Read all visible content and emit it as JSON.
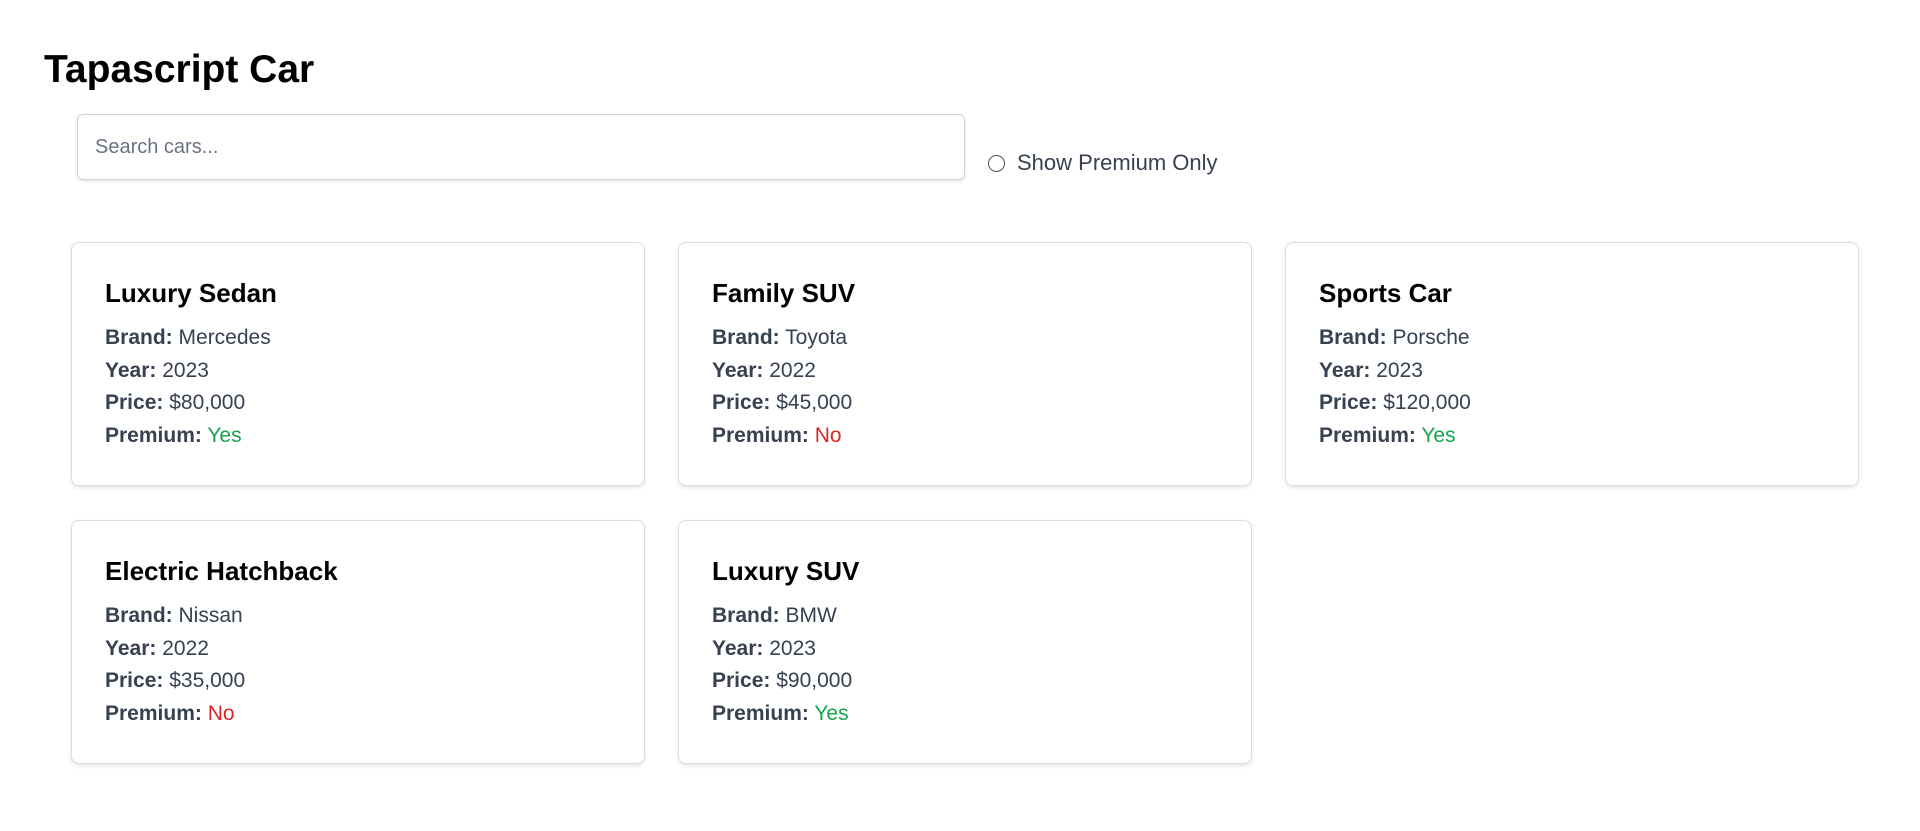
{
  "app": {
    "title": "Tapascript Car"
  },
  "controls": {
    "search_placeholder": "Search cars...",
    "search_value": "",
    "premium_label": "Show Premium Only",
    "premium_checked": false
  },
  "labels": {
    "brand": "Brand:",
    "year": "Year:",
    "price": "Price:",
    "premium": "Premium:"
  },
  "colors": {
    "yes": "#16a34a",
    "no": "#dc2626"
  },
  "cars": [
    {
      "name": "Luxury Sedan",
      "brand": "Mercedes",
      "year": "2023",
      "price": "$80,000",
      "premium": "Yes"
    },
    {
      "name": "Family SUV",
      "brand": "Toyota",
      "year": "2022",
      "price": "$45,000",
      "premium": "No"
    },
    {
      "name": "Sports Car",
      "brand": "Porsche",
      "year": "2023",
      "price": "$120,000",
      "premium": "Yes"
    },
    {
      "name": "Electric Hatchback",
      "brand": "Nissan",
      "year": "2022",
      "price": "$35,000",
      "premium": "No"
    },
    {
      "name": "Luxury SUV",
      "brand": "BMW",
      "year": "2023",
      "price": "$90,000",
      "premium": "Yes"
    }
  ]
}
